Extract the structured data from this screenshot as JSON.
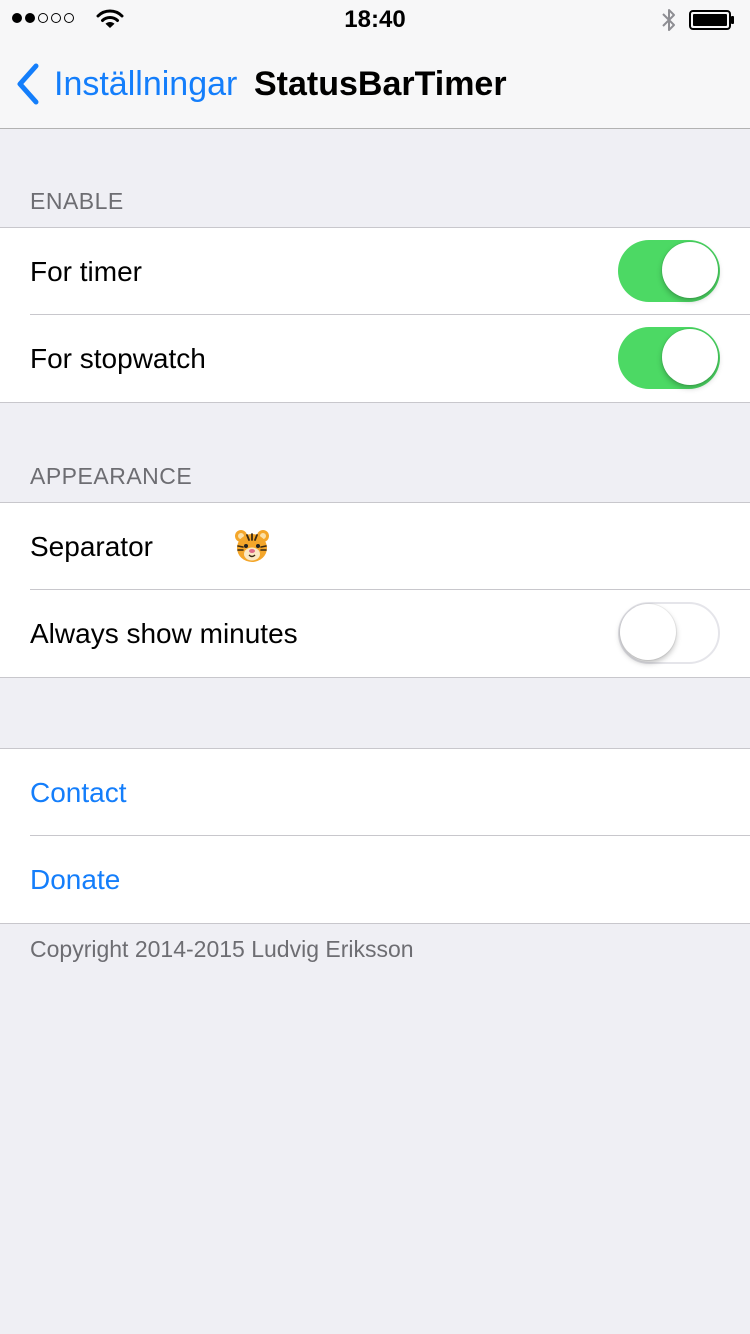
{
  "status_bar": {
    "time": "18:40",
    "signal_icon": "signal-dots-icon",
    "wifi_icon": "wifi-icon",
    "bluetooth_icon": "bluetooth-icon",
    "battery_icon": "battery-icon"
  },
  "nav": {
    "back_label": "Inställningar",
    "back_icon": "chevron-left-icon",
    "title": "StatusBarTimer"
  },
  "sections": {
    "enable": {
      "header": "ENABLE",
      "rows": [
        {
          "label": "For timer",
          "toggle": true
        },
        {
          "label": "For stopwatch",
          "toggle": true
        }
      ]
    },
    "appearance": {
      "header": "APPEARANCE",
      "separator_label": "Separator",
      "separator_value_icon": "tiger-face-icon",
      "always_show_minutes_label": "Always show minutes",
      "always_show_minutes": false
    },
    "links": {
      "contact": "Contact",
      "donate": "Donate"
    }
  },
  "footer": {
    "copyright": "Copyright 2014-2015 Ludvig Eriksson"
  },
  "colors": {
    "accent": "#147efb",
    "switch_on": "#4cd964",
    "background": "#efeff4",
    "section_text": "#6d6d72"
  }
}
